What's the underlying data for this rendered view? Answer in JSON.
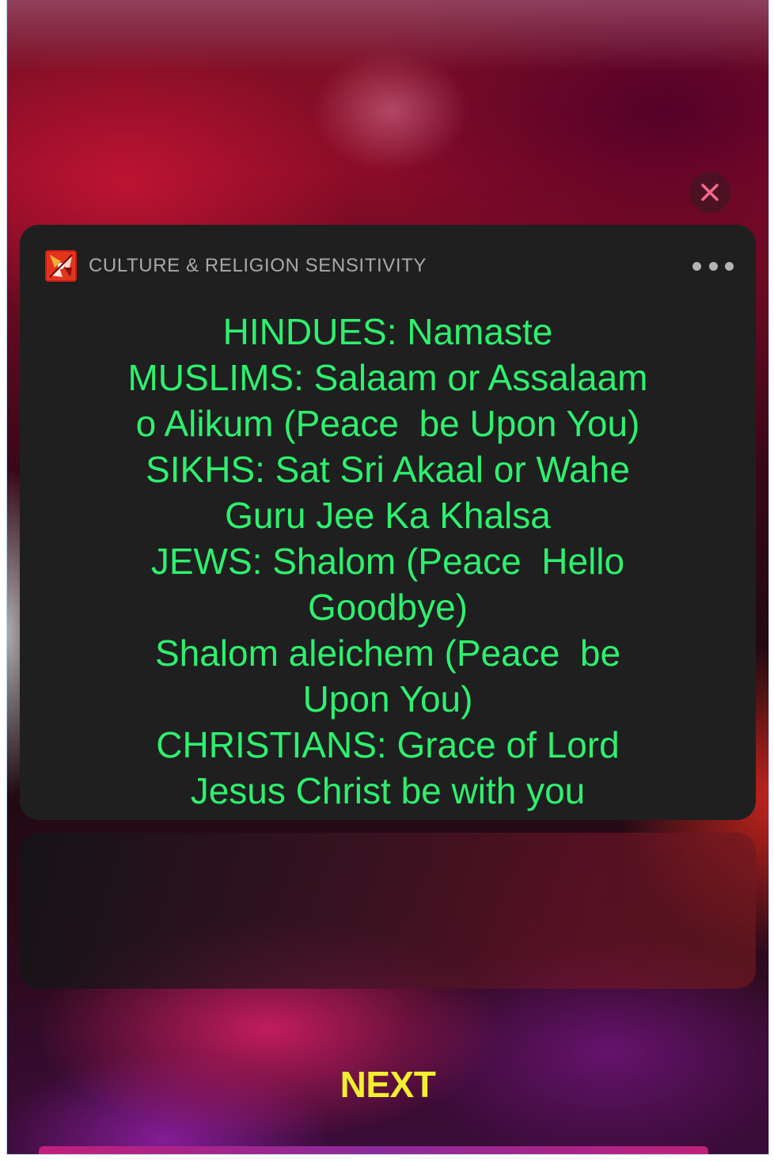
{
  "notification": {
    "app_name": "CULTURE & RELIGION SENSITIVITY",
    "icon": "app-logo-icon",
    "message_lines": [
      "HINDUES: Namaste",
      "MUSLIMS: Salaam or Assalaam",
      "o Alikum (Peace  be Upon You)",
      "SIKHS: Sat Sri Akaal or Wahe",
      "Guru Jee Ka Khalsa",
      "JEWS: Shalom (Peace  Hello",
      "Goodbye)",
      "Shalom aleichem (Peace  be",
      "Upon You)",
      "CHRISTIANS: Grace of Lord",
      "Jesus Christ be with you"
    ],
    "text_color": "#2ef06e"
  },
  "controls": {
    "close_icon": "close-icon",
    "more_icon": "more-options-icon",
    "next_label": "NEXT",
    "next_color": "#f2ee30"
  }
}
